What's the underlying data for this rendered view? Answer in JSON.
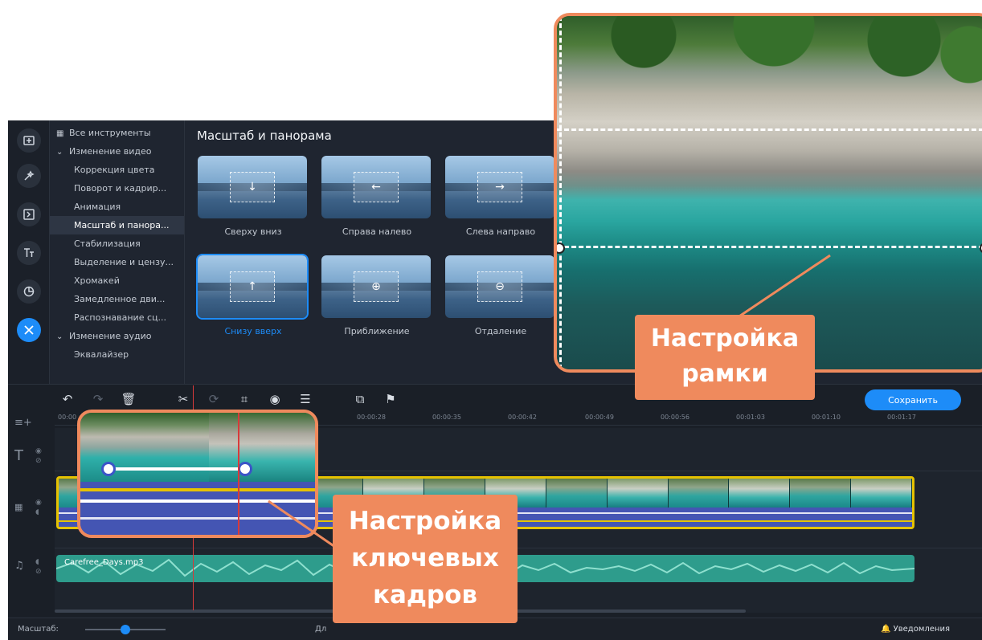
{
  "colors": {
    "accent": "#1d8cf8",
    "callout": "#ef8a5d",
    "clip_border": "#e6c200",
    "playhead": "#d83a3a"
  },
  "rail": [
    {
      "name": "import-icon"
    },
    {
      "name": "magic-wand-icon"
    },
    {
      "name": "transitions-icon"
    },
    {
      "name": "titles-icon"
    },
    {
      "name": "stickers-icon"
    },
    {
      "name": "tools-icon"
    }
  ],
  "tools": {
    "all_tools": "Все инструменты",
    "video_group": "Изменение видео",
    "items": [
      "Коррекция цвета",
      "Поворот и кадрир...",
      "Анимация",
      "Масштаб и панора...",
      "Стабилизация",
      "Выделение и цензу...",
      "Хромакей",
      "Замедленное дви...",
      "Распознавание сц..."
    ],
    "audio_group": "Изменение аудио",
    "audio_items": [
      "Эквалайзер"
    ]
  },
  "panel": {
    "title": "Масштаб и панорама",
    "presets": [
      {
        "label": "Сверху вниз",
        "arrow": "↓"
      },
      {
        "label": "Справа налево",
        "arrow": "←"
      },
      {
        "label": "Слева направо",
        "arrow": "→"
      },
      {
        "label": "Снизу вверх",
        "arrow": "↑"
      },
      {
        "label": "Приближение",
        "arrow": "⊕"
      },
      {
        "label": "Отдаление",
        "arrow": "⊖"
      }
    ]
  },
  "timeline": {
    "save": "Сохранить",
    "ruler": [
      "00:00",
      "00:00:28",
      "00:00:35",
      "00:00:42",
      "00:00:49",
      "00:00:56",
      "00:01:03",
      "00:01:10",
      "00:01:17"
    ],
    "audio_clip": "Carefree_Days.mp3"
  },
  "status": {
    "zoom_label": "Масштаб:",
    "duration_label": "Дл",
    "notifications": "Уведомления",
    "zoom_level": 0.5
  },
  "callouts": {
    "frame": "Настройка рамки",
    "frame_line1": "Настройка",
    "frame_line2": "рамки",
    "keyframes_line1": "Настройка",
    "keyframes_line2": "ключевых",
    "keyframes_line3": "кадров"
  }
}
